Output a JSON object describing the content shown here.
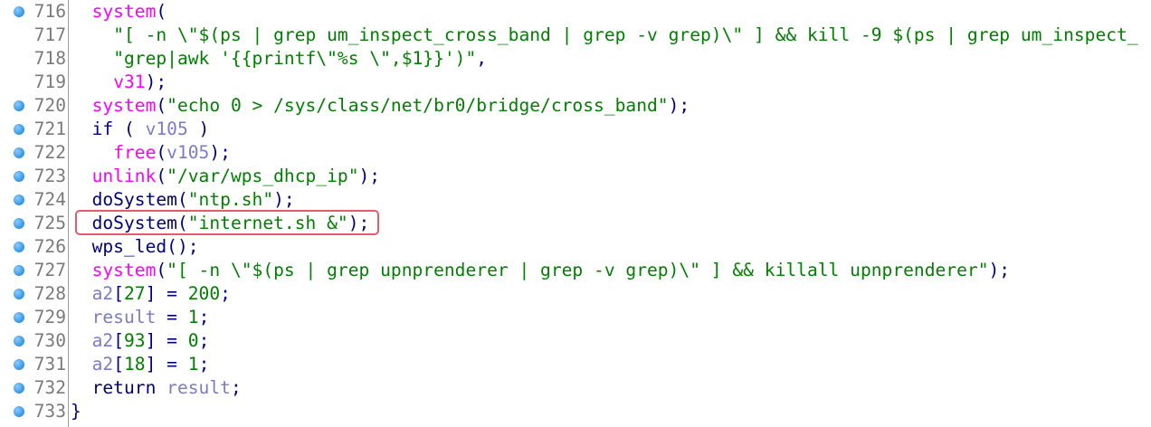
{
  "colors": {
    "function": "#ff00ff",
    "string": "#008000",
    "variable": "#7b7bc8",
    "keyword": "#000080",
    "line_number": "#7a7a7a",
    "breakpoint": "#3d9be6",
    "highlight": "#e35b6d"
  },
  "icons": {
    "breakpoint": "breakpoint-dot-icon"
  },
  "lines": [
    {
      "num": "716",
      "bp": true,
      "tokens": [
        [
          "p",
          "  "
        ],
        [
          "f",
          "system"
        ],
        [
          "p",
          "("
        ]
      ]
    },
    {
      "num": "717",
      "bp": false,
      "tokens": [
        [
          "p",
          "    "
        ],
        [
          "s",
          "\"[ -n \\\"$(ps | grep um_inspect_cross_band | grep -v grep)\\\" ] && kill -9 $(ps | grep um_inspect_"
        ]
      ]
    },
    {
      "num": "718",
      "bp": false,
      "tokens": [
        [
          "p",
          "    "
        ],
        [
          "s",
          "\"grep|awk '{{printf\\\"%s \\\",$1}}')\""
        ],
        [
          "p",
          ","
        ]
      ]
    },
    {
      "num": "719",
      "bp": false,
      "tokens": [
        [
          "p",
          "    "
        ],
        [
          "f",
          "v31"
        ],
        [
          "p",
          ");"
        ]
      ]
    },
    {
      "num": "720",
      "bp": true,
      "tokens": [
        [
          "p",
          "  "
        ],
        [
          "f",
          "system"
        ],
        [
          "p",
          "("
        ],
        [
          "s",
          "\"echo 0 > /sys/class/net/br0/bridge/cross_band\""
        ],
        [
          "p",
          ");"
        ]
      ]
    },
    {
      "num": "721",
      "bp": true,
      "tokens": [
        [
          "p",
          "  if ( "
        ],
        [
          "v",
          "v105"
        ],
        [
          "p",
          " )"
        ]
      ]
    },
    {
      "num": "722",
      "bp": true,
      "tokens": [
        [
          "p",
          "    "
        ],
        [
          "f",
          "free"
        ],
        [
          "p",
          "("
        ],
        [
          "v",
          "v105"
        ],
        [
          "p",
          ");"
        ]
      ]
    },
    {
      "num": "723",
      "bp": true,
      "tokens": [
        [
          "p",
          "  "
        ],
        [
          "f",
          "unlink"
        ],
        [
          "p",
          "("
        ],
        [
          "s",
          "\"/var/wps_dhcp_ip\""
        ],
        [
          "p",
          ");"
        ]
      ]
    },
    {
      "num": "724",
      "bp": true,
      "tokens": [
        [
          "p",
          "  doSystem("
        ],
        [
          "s",
          "\"ntp.sh\""
        ],
        [
          "p",
          ");"
        ]
      ]
    },
    {
      "num": "725",
      "bp": true,
      "tokens": [
        [
          "p",
          "  doSystem("
        ],
        [
          "s",
          "\"internet.sh &\""
        ],
        [
          "p",
          ");"
        ]
      ]
    },
    {
      "num": "726",
      "bp": true,
      "tokens": [
        [
          "p",
          "  wps_led();"
        ]
      ]
    },
    {
      "num": "727",
      "bp": true,
      "tokens": [
        [
          "p",
          "  "
        ],
        [
          "f",
          "system"
        ],
        [
          "p",
          "("
        ],
        [
          "s",
          "\"[ -n \\\"$(ps | grep upnprenderer | grep -v grep)\\\" ] && killall upnprenderer\""
        ],
        [
          "p",
          ");"
        ]
      ]
    },
    {
      "num": "728",
      "bp": true,
      "tokens": [
        [
          "p",
          "  "
        ],
        [
          "v",
          "a2"
        ],
        [
          "p",
          "["
        ],
        [
          "s",
          "27"
        ],
        [
          "p",
          "] = "
        ],
        [
          "s",
          "200"
        ],
        [
          "p",
          ";"
        ]
      ]
    },
    {
      "num": "729",
      "bp": true,
      "tokens": [
        [
          "p",
          "  "
        ],
        [
          "v",
          "result"
        ],
        [
          "p",
          " = "
        ],
        [
          "s",
          "1"
        ],
        [
          "p",
          ";"
        ]
      ]
    },
    {
      "num": "730",
      "bp": true,
      "tokens": [
        [
          "p",
          "  "
        ],
        [
          "v",
          "a2"
        ],
        [
          "p",
          "["
        ],
        [
          "s",
          "93"
        ],
        [
          "p",
          "] = "
        ],
        [
          "s",
          "0"
        ],
        [
          "p",
          ";"
        ]
      ]
    },
    {
      "num": "731",
      "bp": true,
      "tokens": [
        [
          "p",
          "  "
        ],
        [
          "v",
          "a2"
        ],
        [
          "p",
          "["
        ],
        [
          "s",
          "18"
        ],
        [
          "p",
          "] = "
        ],
        [
          "s",
          "1"
        ],
        [
          "p",
          ";"
        ]
      ]
    },
    {
      "num": "732",
      "bp": true,
      "tokens": [
        [
          "p",
          "  return "
        ],
        [
          "v",
          "result"
        ],
        [
          "p",
          ";"
        ]
      ]
    },
    {
      "num": "733",
      "bp": true,
      "tokens": [
        [
          "p",
          "}"
        ]
      ]
    }
  ],
  "highlighted_line": "725"
}
